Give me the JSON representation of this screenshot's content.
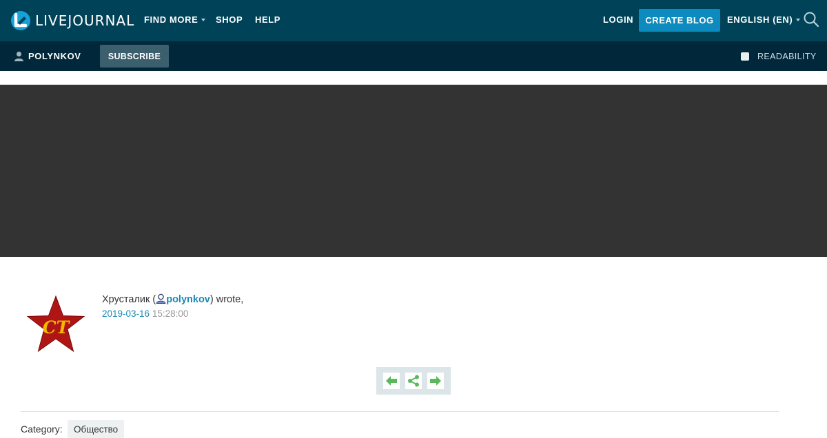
{
  "topbar": {
    "logo_text": "LIVEJOURNAL",
    "find_more": "FIND MORE",
    "shop": "SHOP",
    "help": "HELP",
    "login": "LOGIN",
    "create_blog": "CREATE BLOG",
    "language": "ENGLISH (EN)"
  },
  "subbar": {
    "username": "POLYNKOV",
    "subscribe": "SUBSCRIBE",
    "readability": "READABILITY"
  },
  "post": {
    "author_name": "Хрусталик (",
    "username": "polynkov",
    "wrote": ") wrote,",
    "date": "2019-03-16",
    "time": "15:28:00"
  },
  "footer": {
    "category_label": "Category:",
    "category_value": "Общество"
  },
  "icons": {
    "prev": "arrow-left-icon",
    "share": "share-icon",
    "next": "arrow-right-icon"
  },
  "colors": {
    "topbar_bg": "#004359",
    "subbar_bg": "#00283a",
    "accent": "#0d8bbe",
    "link": "#1a8bb5",
    "banner_bg": "#333333",
    "nav_green": "#5cb85c"
  }
}
